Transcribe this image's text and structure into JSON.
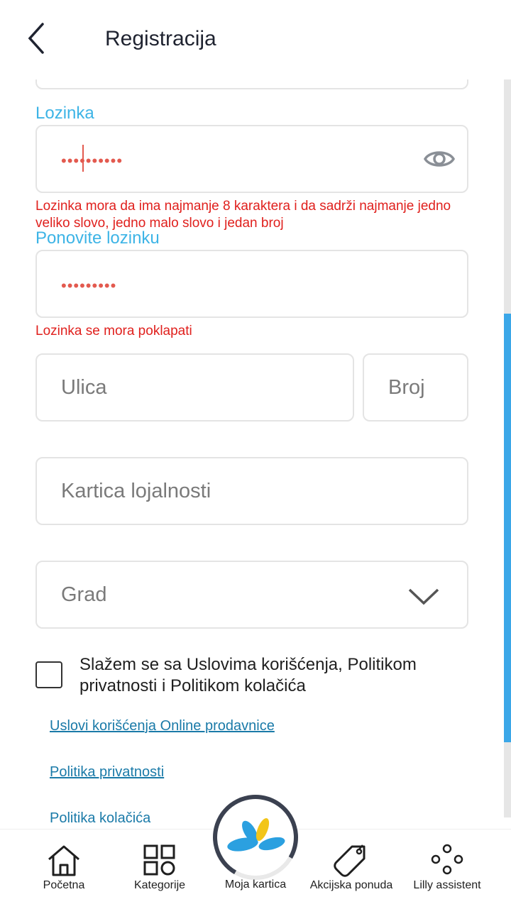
{
  "header": {
    "title": "Registracija"
  },
  "form": {
    "password": {
      "label": "Lozinka",
      "value": "••••••••••",
      "error": "Lozinka mora da ima najmanje 8 karaktera i da sadrži najmanje jedno veliko slovo, jedno malo slovo i jedan broj"
    },
    "repeat_password": {
      "label": "Ponovite lozinku",
      "value": "•••••••••",
      "error": "Lozinka se mora poklapati"
    },
    "street": {
      "placeholder": "Ulica"
    },
    "number": {
      "placeholder": "Broj"
    },
    "loyalty_card": {
      "placeholder": "Kartica lojalnosti"
    },
    "city": {
      "placeholder": "Grad"
    },
    "agree_text": "Slažem se sa Uslovima korišćenja, Politikom privatnosti i Politikom kolačića",
    "links": [
      "Uslovi korišćenja Online prodavnice",
      "Politika privatnosti",
      "Politika kolačića"
    ]
  },
  "nav": {
    "items": [
      "Početna",
      "Kategorije",
      "Moja kartica",
      "Akcijska ponuda",
      "Lilly assistent"
    ]
  },
  "colors": {
    "accent": "#3db4e6",
    "error": "#e0201d",
    "link": "#1a7aa8",
    "scroll": "#3ba7e8"
  }
}
